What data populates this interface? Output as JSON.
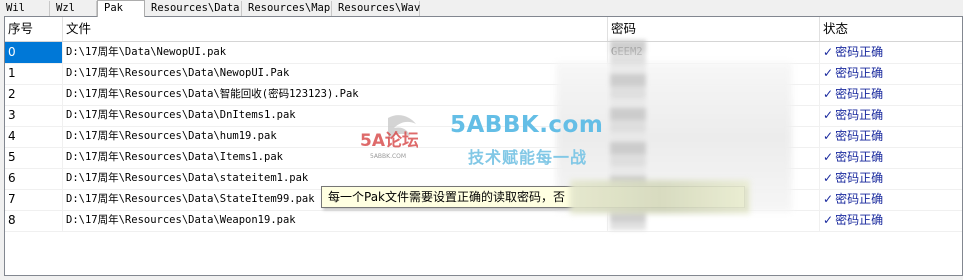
{
  "tabs": [
    {
      "label": "Wil"
    },
    {
      "label": "Wzl"
    },
    {
      "label": "Pak"
    },
    {
      "label": "Resources\\Data"
    },
    {
      "label": "Resources\\Map"
    },
    {
      "label": "Resources\\Wav"
    }
  ],
  "active_tab": "Pak",
  "columns": {
    "index": "序号",
    "file": "文件",
    "password": "密码",
    "status": "状态"
  },
  "rows": [
    {
      "index": "0",
      "file": "D:\\17周年\\Data\\NewopUI.pak",
      "password": "GEEM2",
      "status": "密码正确"
    },
    {
      "index": "1",
      "file": "D:\\17周年\\Resources\\Data\\NewopUI.Pak",
      "password": "",
      "status": "密码正确"
    },
    {
      "index": "2",
      "file": "D:\\17周年\\Resources\\Data\\智能回收(密码123123).Pak",
      "password": "",
      "status": "密码正确"
    },
    {
      "index": "3",
      "file": "D:\\17周年\\Resources\\Data\\DnItems1.pak",
      "password": "",
      "status": "密码正确"
    },
    {
      "index": "4",
      "file": "D:\\17周年\\Resources\\Data\\hum19.pak",
      "password": "",
      "status": "密码正确"
    },
    {
      "index": "5",
      "file": "D:\\17周年\\Resources\\Data\\Items1.pak",
      "password": "",
      "status": "密码正确"
    },
    {
      "index": "6",
      "file": "D:\\17周年\\Resources\\Data\\stateitem1.pak",
      "password": "",
      "status": "密码正确"
    },
    {
      "index": "7",
      "file": "D:\\17周年\\Resources\\Data\\StateItem99.pak",
      "password": "",
      "status": "密码正确"
    },
    {
      "index": "8",
      "file": "D:\\17周年\\Resources\\Data\\Weapon19.pak",
      "password": "",
      "status": "密码正确"
    }
  ],
  "tooltip": "每一个Pak文件需要设置正确的读取密码，否",
  "watermark": {
    "site": "5ABBK.com",
    "slogan": "技术赋能每一战",
    "logo_text": "5A论坛",
    "logo_sub": "5ABBK.COM"
  },
  "colors": {
    "selection": "#0078d7",
    "status_text": "#1a2a9e",
    "tooltip_bg": "#ffffe1"
  }
}
